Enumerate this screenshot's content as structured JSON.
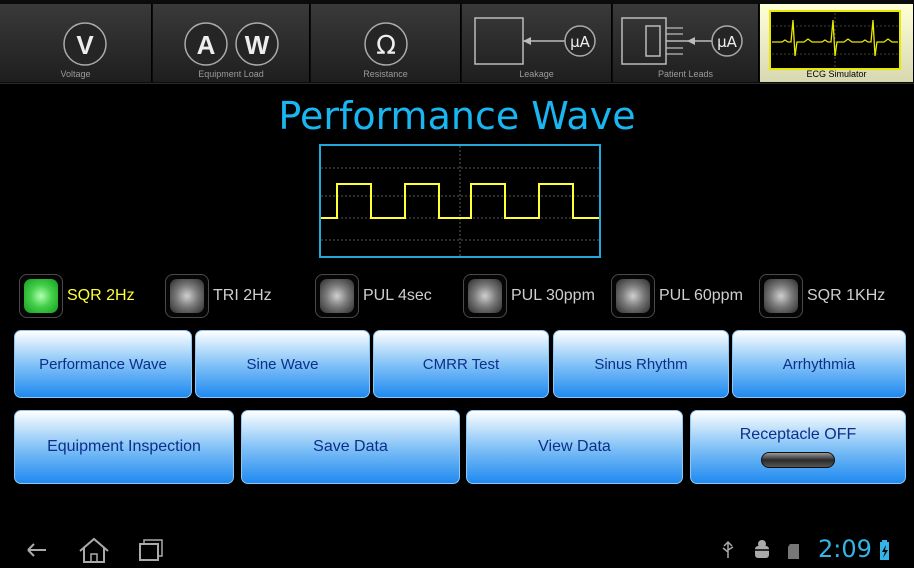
{
  "tabs": [
    {
      "label": "Voltage",
      "icon": "voltage-icon",
      "glyphs": [
        "V"
      ]
    },
    {
      "label": "Equipment Load",
      "icon": "equipment-load-icon",
      "glyphs": [
        "A",
        "W"
      ]
    },
    {
      "label": "Resistance",
      "icon": "resistance-icon",
      "glyphs": [
        "Ω"
      ]
    },
    {
      "label": "Leakage",
      "icon": "leakage-icon",
      "glyphs": [
        "µA"
      ]
    },
    {
      "label": "Patient Leads",
      "icon": "patient-leads-icon",
      "glyphs": [
        "µA"
      ]
    },
    {
      "label": "ECG Simulator",
      "icon": "ecg-simulator-icon",
      "glyphs": [],
      "active": true
    }
  ],
  "page_title": "Performance Wave",
  "wave_options": [
    {
      "label": "SQR 2Hz",
      "selected": true
    },
    {
      "label": "TRI 2Hz",
      "selected": false
    },
    {
      "label": "PUL 4sec",
      "selected": false
    },
    {
      "label": "PUL 30ppm",
      "selected": false
    },
    {
      "label": "PUL 60ppm",
      "selected": false
    },
    {
      "label": "SQR 1KHz",
      "selected": false
    }
  ],
  "mode_buttons": [
    "Performance Wave",
    "Sine Wave",
    "CMRR Test",
    "Sinus Rhythm",
    "Arrhythmia"
  ],
  "action_buttons": {
    "inspection": "Equipment Inspection",
    "save": "Save Data",
    "view": "View Data",
    "receptacle": "Receptacle OFF"
  },
  "status": {
    "time": "2:09"
  },
  "colors": {
    "accent": "#19b6f2",
    "wave": "#ffff33",
    "led_on": "#44d04a",
    "button_text": "#0d2f8a"
  }
}
